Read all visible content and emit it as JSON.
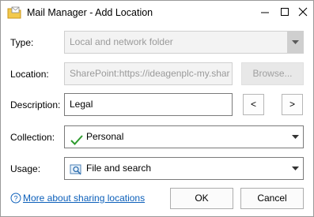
{
  "window": {
    "title": "Mail Manager - Add Location",
    "icon": "folder-mail-icon",
    "controls": {
      "minimize": "minimize-icon",
      "maximize": "maximize-icon",
      "close": "close-icon"
    }
  },
  "form": {
    "type": {
      "label": "Type:",
      "value": "Local and network folder",
      "enabled": false
    },
    "location": {
      "label": "Location:",
      "value": "SharePoint:https://ideagenplc-my.shar",
      "browse_label": "Browse...",
      "enabled": false
    },
    "description": {
      "label": "Description:",
      "value": "Legal",
      "prev_label": "<",
      "next_label": ">"
    },
    "collection": {
      "label": "Collection:",
      "value": "Personal",
      "icon": "checkmark-icon"
    },
    "usage": {
      "label": "Usage:",
      "value": "File and search",
      "icon": "search-document-icon"
    }
  },
  "footer": {
    "help_link": "More about sharing locations",
    "ok_label": "OK",
    "cancel_label": "Cancel"
  },
  "colors": {
    "link": "#0b5fba",
    "check": "#2e9b2e",
    "folder": "#e8b838"
  }
}
